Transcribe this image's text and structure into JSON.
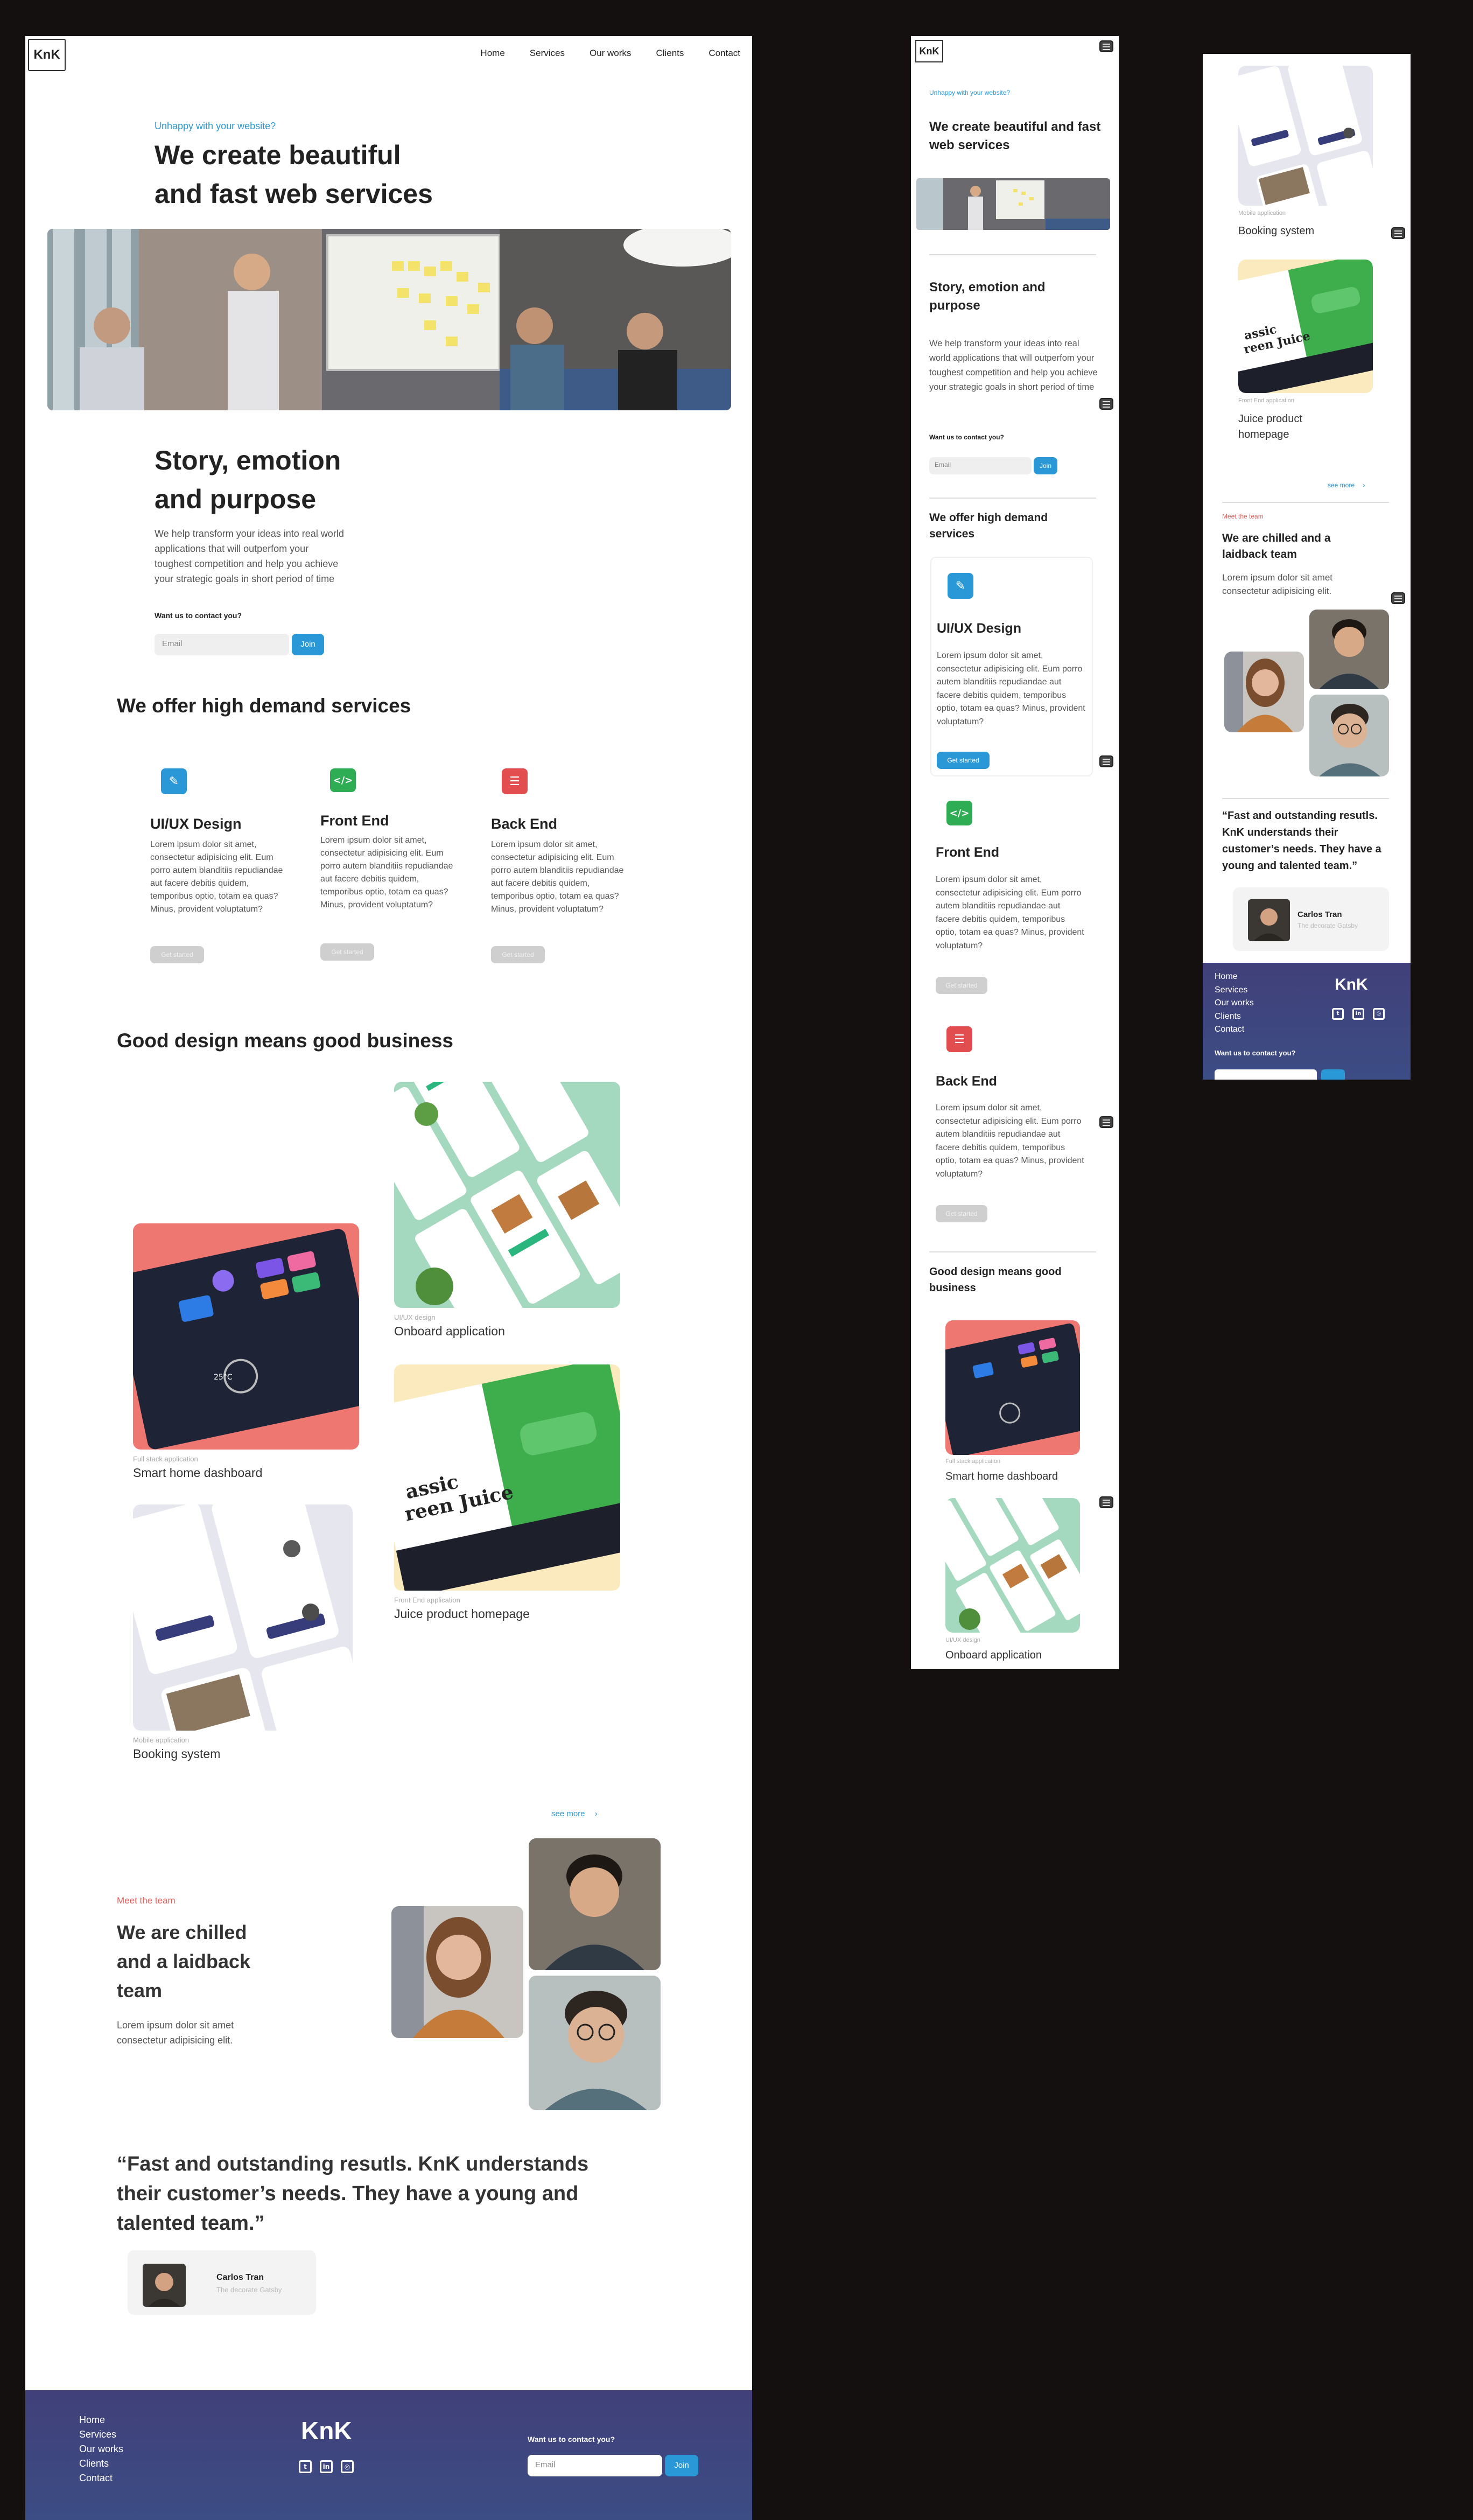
{
  "brand": "KnK",
  "nav": [
    "Home",
    "Services",
    "Our works",
    "Clients",
    "Contact"
  ],
  "hero": {
    "eyebrow": "Unhappy with your website?",
    "title_line1": "We create beautiful",
    "title_line2": "and fast web services",
    "title_mobile": "We create beautiful and fast web services"
  },
  "story": {
    "title_line1": "Story, emotion",
    "title_line2": "and purpose",
    "title_mobile": "Story, emotion and purpose",
    "body": "We help transform your ideas into real world applications that will outperfom your toughest competition and help you achieve your strategic goals in short period of time",
    "contact_label": "Want us to contact you?",
    "email_placeholder": "Email",
    "join_label": "Join"
  },
  "services": {
    "title": "We offer high demand services",
    "items": [
      {
        "title": "UI/UX Design",
        "icon": "pen-icon",
        "color": "#2a97d6",
        "text": "Lorem ipsum dolor sit amet, consectetur adipisicing elit. Eum porro autem blanditiis repudiandae aut facere debitis quidem, temporibus optio, totam ea quas? Minus, provident voluptatum?",
        "cta": "Get started"
      },
      {
        "title": "Front End",
        "icon": "code-icon",
        "color": "#2fad55",
        "text": "Lorem ipsum dolor sit amet, consectetur adipisicing elit. Eum porro autem blanditiis repudiandae aut facere debitis quidem, temporibus optio, totam ea quas? Minus, provident voluptatum?",
        "cta": "Get started"
      },
      {
        "title": "Back End",
        "icon": "server-icon",
        "color": "#e24d4f",
        "text": "Lorem ipsum dolor sit amet, consectetur adipisicing elit. Eum porro autem blanditiis repudiandae aut facere debitis quidem, temporibus optio, totam ea quas? Minus, provident voluptatum?",
        "cta": "Get started"
      }
    ]
  },
  "works": {
    "title": "Good design means good business",
    "items": [
      {
        "category": "UI/UX design",
        "title": "Onboard application"
      },
      {
        "category": "Full stack application",
        "title": "Smart home dashboard"
      },
      {
        "category": "Front End application",
        "title": "Juice product homepage"
      },
      {
        "category": "Mobile application",
        "title": "Booking system"
      }
    ],
    "see_more": "see more",
    "juice_text": "assic reen Juice"
  },
  "team": {
    "eyebrow": "Meet the team",
    "title_line1": "We are chilled",
    "title_line2": "and a laidback",
    "title_line3": "team",
    "title_mobile": "We are chilled and a laidback team",
    "body": "Lorem ipsum dolor sit amet consectetur adipisicing elit."
  },
  "testimonial": {
    "quote": "“Fast and outstanding resutls. KnK understands their customer’s needs. They have a young and talented team.”",
    "name": "Carlos Tran",
    "role": "The decorate Gatsby"
  },
  "footer": {
    "links": [
      "Home",
      "Services",
      "Our works",
      "Clients",
      "Contact"
    ],
    "logo": "KnK",
    "contact_label": "Want us to contact you?",
    "email_placeholder": "Email",
    "join_label": "Join",
    "social": [
      "twitter-icon",
      "linkedin-icon",
      "instagram-icon"
    ]
  },
  "colors": {
    "accent": "#2a97d6",
    "red": "#e24d4f",
    "green": "#2fad55",
    "eyebrow_red": "#e2605a"
  }
}
